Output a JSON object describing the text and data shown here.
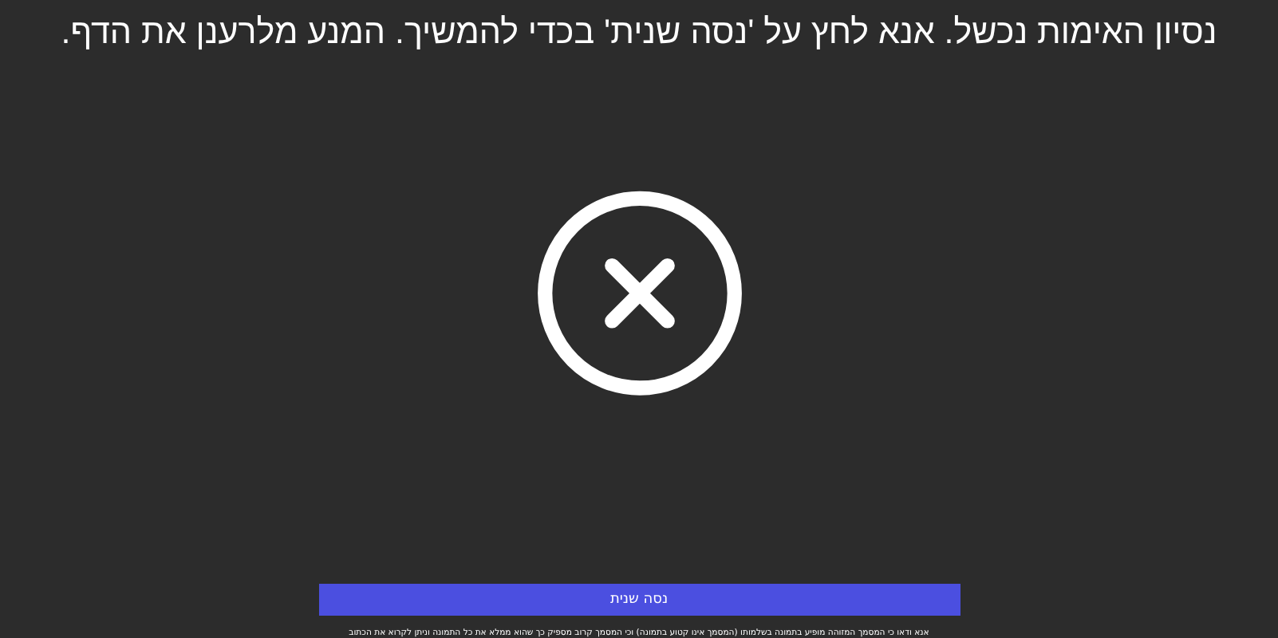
{
  "message": "נסיון האימות נכשל. אנא לחץ על 'נסה שנית' בכדי להמשיך. המנע מלרענן את הדף.",
  "retry_button": {
    "label": "נסה שנית"
  },
  "hint": "אנא ודאו כי המסמך המזוהה מופיע בתמונה בשלמותו (המסמך אינו קטוע בתמונה) וכי המסמך קרוב מספיק כך שהוא ממלא את כל התמונה וניתן לקרוא את הכתוב"
}
